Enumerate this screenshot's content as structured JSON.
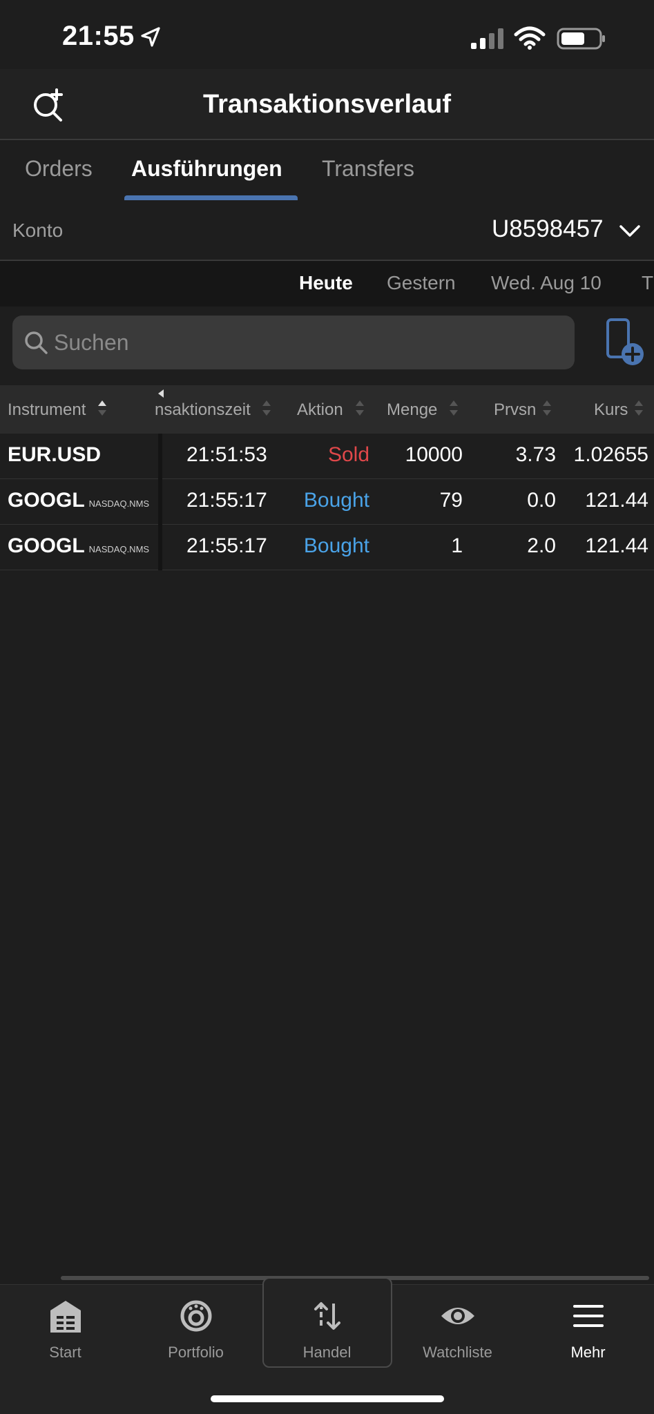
{
  "status_bar": {
    "time": "21:55"
  },
  "header": {
    "title": "Transaktionsverlauf"
  },
  "tabs": [
    {
      "label": "Orders",
      "active": false
    },
    {
      "label": "Ausführungen",
      "active": true
    },
    {
      "label": "Transfers",
      "active": false
    }
  ],
  "account": {
    "label": "Konto",
    "value": "U8598457"
  },
  "date_filter": [
    {
      "label": "Heute",
      "active": true
    },
    {
      "label": "Gestern",
      "active": false
    },
    {
      "label": "Wed. Aug 10",
      "active": false
    },
    {
      "label": "T",
      "active": false
    }
  ],
  "search": {
    "placeholder": "Suchen"
  },
  "table": {
    "columns": [
      "Instrument",
      "nsaktionszeit",
      "Aktion",
      "Menge",
      "Prvsn",
      "Kurs"
    ],
    "rows": [
      {
        "instrument": "EUR.USD",
        "exchange": "",
        "time": "21:51:53",
        "action": "Sold",
        "quantity": "10000",
        "commission": "3.73",
        "price": "1.02655"
      },
      {
        "instrument": "GOOGL",
        "exchange": "NASDAQ.NMS",
        "time": "21:55:17",
        "action": "Bought",
        "quantity": "79",
        "commission": "0.0",
        "price": "121.44"
      },
      {
        "instrument": "GOOGL",
        "exchange": "NASDAQ.NMS",
        "time": "21:55:17",
        "action": "Bought",
        "quantity": "1",
        "commission": "2.0",
        "price": "121.44"
      }
    ]
  },
  "colors": {
    "sold": "#e0484a",
    "bought": "#4aa3e8",
    "accent": "#4a74b0"
  },
  "bottom_nav": [
    {
      "label": "Start",
      "icon": "start-icon"
    },
    {
      "label": "Portfolio",
      "icon": "portfolio-icon"
    },
    {
      "label": "Handel",
      "icon": "trade-arrows-icon"
    },
    {
      "label": "Watchliste",
      "icon": "eye-icon"
    },
    {
      "label": "Mehr",
      "icon": "menu-icon"
    }
  ]
}
